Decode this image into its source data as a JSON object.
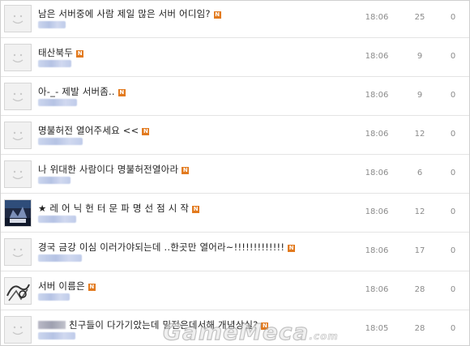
{
  "colors": {
    "new_badge": "#e27a1e",
    "row_divider": "#e4e4e4",
    "meta_text": "#8a8a8a"
  },
  "new_badge_label": "N",
  "posts": [
    {
      "title": "남은 서버중에 사람 제일 많은 서버 어디임?",
      "thumb": "smiley-placeholder",
      "time": "18:06",
      "hits": "25",
      "votes": "0"
    },
    {
      "title": "태산북두",
      "thumb": "smiley-placeholder",
      "time": "18:06",
      "hits": "9",
      "votes": "0"
    },
    {
      "title": "아-_- 제발 서버좀..",
      "thumb": "smiley-placeholder",
      "time": "18:06",
      "hits": "9",
      "votes": "0"
    },
    {
      "title": "명불허전 열어주세요 <<",
      "thumb": "smiley-placeholder",
      "time": "18:06",
      "hits": "12",
      "votes": "0"
    },
    {
      "title": "나 위대한 사람이다 명불허전열아라",
      "thumb": "smiley-placeholder",
      "time": "18:06",
      "hits": "6",
      "votes": "0"
    },
    {
      "title": "★ 레 어 닉 헌 터 문 파 명 선 점 시 작",
      "thumb": "game-avatar",
      "time": "18:06",
      "hits": "12",
      "votes": "0"
    },
    {
      "title": "경국 금강 이심 이러가야되는데 ..한곳만 열어라~!!!!!!!!!!!!!",
      "thumb": "smiley-placeholder",
      "time": "18:06",
      "hits": "17",
      "votes": "0"
    },
    {
      "title": "서버 이름은",
      "thumb": "sketch-avatar",
      "time": "18:06",
      "hits": "28",
      "votes": "0"
    },
    {
      "title": "친구들이 다가기았는데 밀전은데서해 개념상실?",
      "thumb": "smiley-placeholder",
      "time": "18:05",
      "hits": "28",
      "votes": "0"
    }
  ],
  "watermark": {
    "text": "GameMeca",
    "suffix": ".com"
  }
}
